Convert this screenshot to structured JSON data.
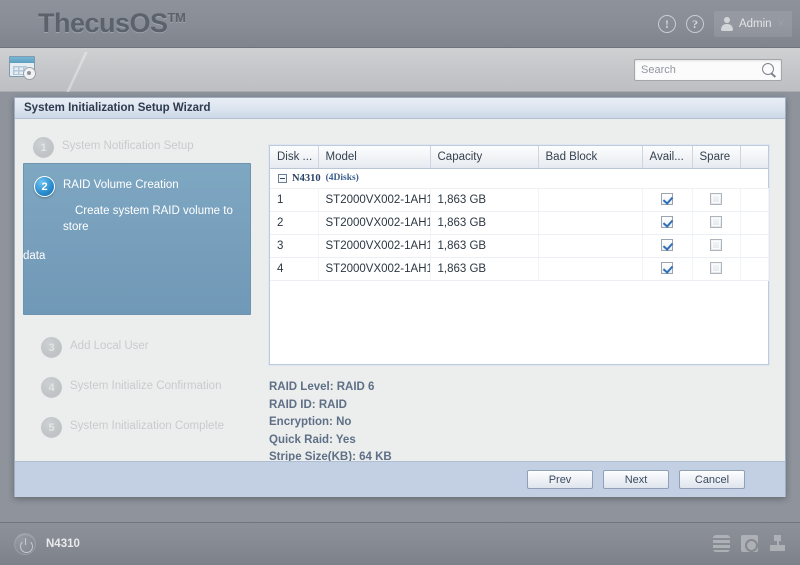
{
  "header": {
    "brand": "ThecusOS",
    "brand_tm": "TM",
    "info_icon_glyph": "!",
    "help_icon_glyph": "?",
    "admin_label": "Admin",
    "admin_close": "×"
  },
  "toolbar": {
    "control_panel_icon": "control-panel-icon",
    "search_placeholder": "Search",
    "search_value": ""
  },
  "wizard": {
    "title": "System Initialization Setup Wizard",
    "steps": [
      {
        "num": "1",
        "label": "System Notification Setup",
        "state": "inactive",
        "desc": ""
      },
      {
        "num": "2",
        "label": "RAID Volume Creation",
        "state": "active",
        "desc": "Create system RAID volume to store",
        "desc_overflow": "data"
      },
      {
        "num": "3",
        "label": "Add Local User",
        "state": "inactive",
        "desc": ""
      },
      {
        "num": "4",
        "label": "System Initialize Confirmation",
        "state": "inactive",
        "desc": ""
      },
      {
        "num": "5",
        "label": "System Initialization Complete",
        "state": "inactive",
        "desc": ""
      }
    ],
    "table": {
      "columns": [
        "Disk ...",
        "Model",
        "Capacity",
        "Bad Block",
        "Avail...",
        "Spare",
        ""
      ],
      "group": {
        "name": "N4310",
        "count": "(4Disks)",
        "expanded": true
      },
      "rows": [
        {
          "disk": "1",
          "model": "ST2000VX002-1AH1",
          "capacity": "1,863 GB",
          "bad_block": "",
          "available": true,
          "spare": false
        },
        {
          "disk": "2",
          "model": "ST2000VX002-1AH1",
          "capacity": "1,863 GB",
          "bad_block": "",
          "available": true,
          "spare": false
        },
        {
          "disk": "3",
          "model": "ST2000VX002-1AH1",
          "capacity": "1,863 GB",
          "bad_block": "",
          "available": true,
          "spare": false
        },
        {
          "disk": "4",
          "model": "ST2000VX002-1AH1",
          "capacity": "1,863 GB",
          "bad_block": "",
          "available": true,
          "spare": false
        }
      ]
    },
    "raid_info": [
      "RAID Level: RAID 6",
      "RAID ID: RAID",
      "Encryption: No",
      "Quick Raid: Yes",
      "Stripe Size(KB): 64 KB"
    ],
    "buttons": {
      "prev": "Prev",
      "next": "Next",
      "cancel": "Cancel"
    }
  },
  "statusbar": {
    "device_name": "N4310",
    "power_icon": "power-icon",
    "icons": [
      "disk-stack-icon",
      "drive-icon",
      "network-icon"
    ]
  },
  "colors": {
    "accent_blue": "#2a8ccd",
    "active_panel": "#779fbc",
    "footer_strip": "#c3d0e3",
    "content_bg": "#eceeee",
    "chrome_gray": "#868b94"
  }
}
